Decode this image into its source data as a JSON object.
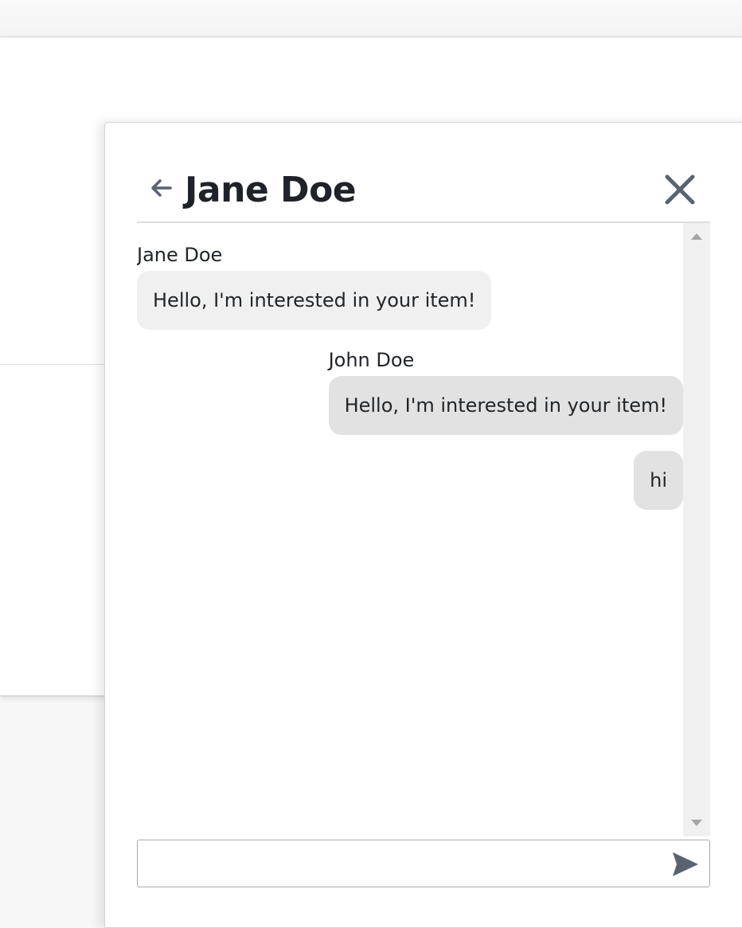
{
  "conversation": {
    "title": "Jane Doe",
    "back_icon": "arrow-left-icon",
    "close_icon": "close-icon",
    "send_icon": "send-icon"
  },
  "messages": [
    {
      "sender": "Jane Doe",
      "text": "Hello, I'm interested in your item!",
      "side": "left"
    },
    {
      "sender": "John Doe",
      "text": "Hello, I'm interested in your item!",
      "side": "right"
    },
    {
      "sender": "",
      "text": "hi",
      "side": "right"
    }
  ],
  "composer": {
    "value": "",
    "placeholder": ""
  },
  "colors": {
    "icon": "#5a6270",
    "incoming_bubble": "#f0f0f0",
    "outgoing_bubble": "#e2e2e2",
    "text": "#212529"
  }
}
